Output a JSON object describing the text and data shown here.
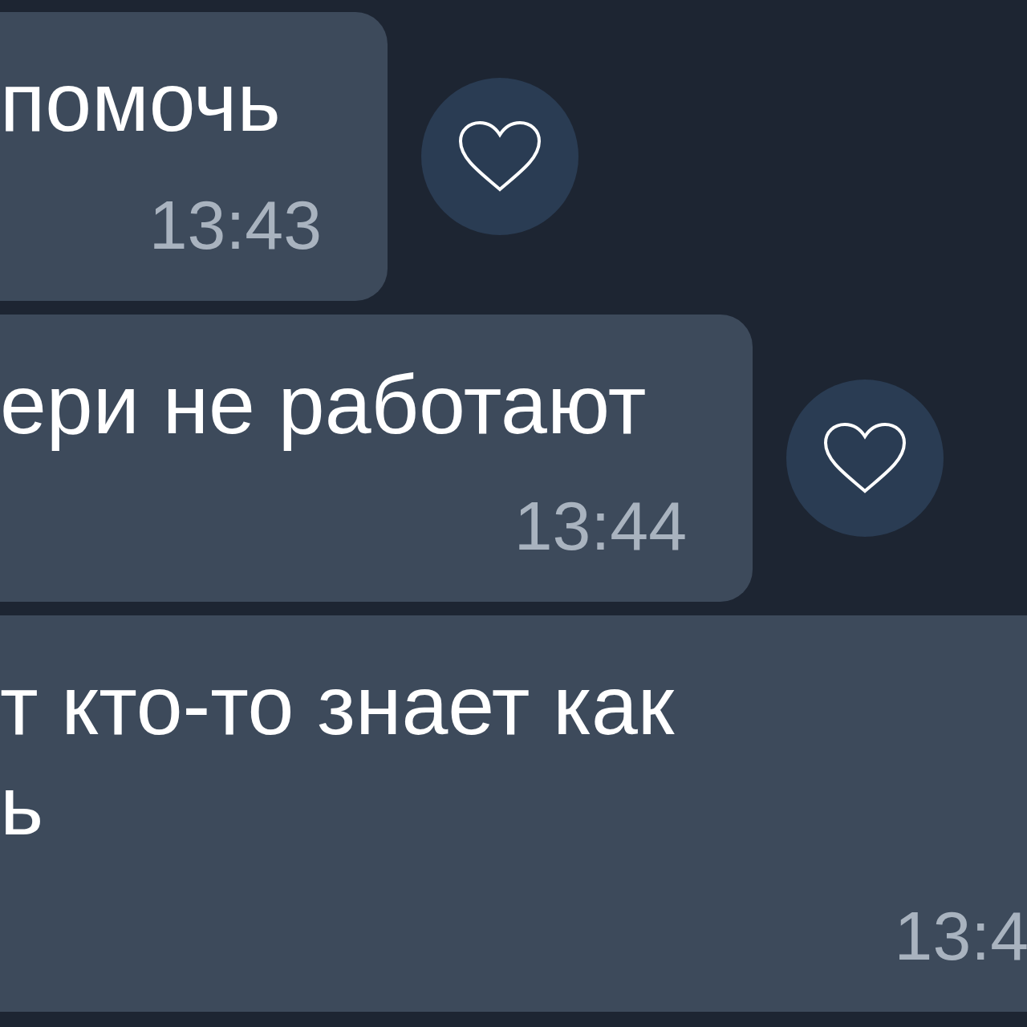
{
  "messages": [
    {
      "lines": [
        "помочь"
      ],
      "time": "13:43",
      "heart_button": true
    },
    {
      "lines": [
        "ери не работают"
      ],
      "time": "13:44",
      "heart_button": true
    },
    {
      "lines": [
        "т кто-то знает как",
        "ь"
      ],
      "time": "13:4"
    }
  ]
}
